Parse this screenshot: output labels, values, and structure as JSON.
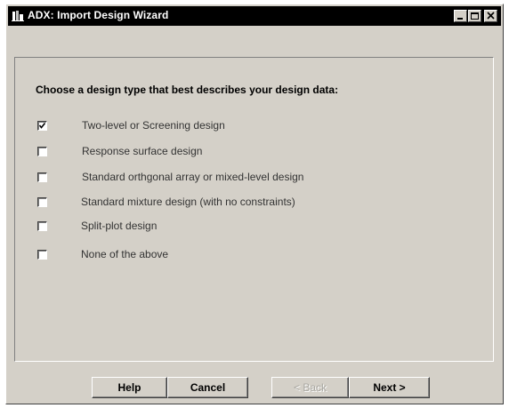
{
  "window": {
    "title": "ADX: Import Design Wizard"
  },
  "prompt": "Choose a design type that best describes your design data:",
  "options": [
    {
      "label": "Two-level or Screening design",
      "checked": true
    },
    {
      "label": "Response surface design",
      "checked": false
    },
    {
      "label": "Standard orthgonal array or mixed-level design",
      "checked": false
    },
    {
      "label": "Standard mixture design (with no constraints)",
      "checked": false
    },
    {
      "label": "Split-plot design",
      "checked": false
    },
    {
      "label": "None of the above",
      "checked": false
    }
  ],
  "buttons": {
    "help": "Help",
    "cancel": "Cancel",
    "back": "< Back",
    "next": "Next >"
  },
  "icons": {
    "app": "app-icon",
    "minimize": "minimize-icon",
    "maximize": "maximize-icon",
    "close": "close-icon",
    "check": "checkmark-icon"
  },
  "colors": {
    "titlebar": "#000000",
    "dialog_face": "#d4d0c8",
    "option_text": "#333333"
  }
}
